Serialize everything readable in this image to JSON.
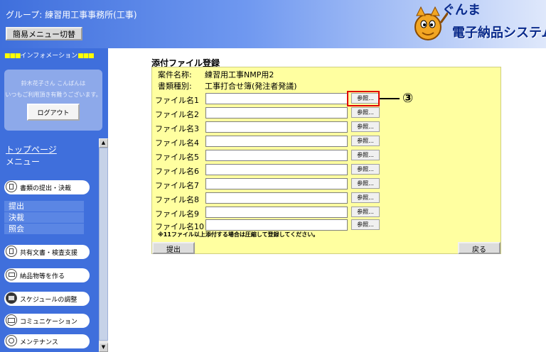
{
  "header": {
    "group_label": "グループ: 練習用工事事務所(工事)",
    "menu_toggle": "簡易メニュー切替",
    "logo_top": "ぐんま",
    "logo_bottom": "電子納品システム"
  },
  "sidebar": {
    "info_squares_left": "■■■",
    "info_title": "インフォメーション",
    "info_squares_right": "■■■",
    "greeting": "鈴木花子さん こんばんは",
    "thanks": "いつもご利用頂き有難うございます。",
    "logout": "ログアウト",
    "top_page": "トップページ",
    "menu_label": "メニュー",
    "menu_items": [
      {
        "label": "書類の提出・決裁",
        "icon": "document-icon"
      },
      {
        "label": "共有文書・検査支援",
        "icon": "shared-document-icon"
      },
      {
        "label": "納品物等を作る",
        "icon": "folder-icon"
      },
      {
        "label": "スケジュールの調整",
        "icon": "calendar-icon"
      },
      {
        "label": "コミュニケーション",
        "icon": "mail-icon"
      },
      {
        "label": "メンテナンス",
        "icon": "wrench-icon"
      }
    ],
    "sub_items": [
      "提出",
      "決裁",
      "照会"
    ]
  },
  "form": {
    "title": "添付ファイル登録",
    "case_label": "案件名称:",
    "case_value": "練習用工事NMP用2",
    "type_label": "書類種別:",
    "type_value": "工事打合せ簿(発注者発議)",
    "browse_label": "参照...",
    "files": [
      {
        "label": "ファイル名1",
        "value": ""
      },
      {
        "label": "ファイル名2",
        "value": ""
      },
      {
        "label": "ファイル名3",
        "value": ""
      },
      {
        "label": "ファイル名4",
        "value": ""
      },
      {
        "label": "ファイル名5",
        "value": ""
      },
      {
        "label": "ファイル名6",
        "value": ""
      },
      {
        "label": "ファイル名7",
        "value": ""
      },
      {
        "label": "ファイル名8",
        "value": ""
      },
      {
        "label": "ファイル名9",
        "value": ""
      },
      {
        "label": "ファイル名10",
        "value": ""
      }
    ],
    "note": "※11ファイル以上添付する場合は圧縮して登録してください。",
    "submit": "提出",
    "back": "戻る"
  },
  "annotation": {
    "callout": "③",
    "highlight_color": "#e00000"
  },
  "colors": {
    "sidebar_bg": "#3f6fdc",
    "panel_bg": "#ffffa0",
    "logo_text": "#0a2b8c"
  }
}
